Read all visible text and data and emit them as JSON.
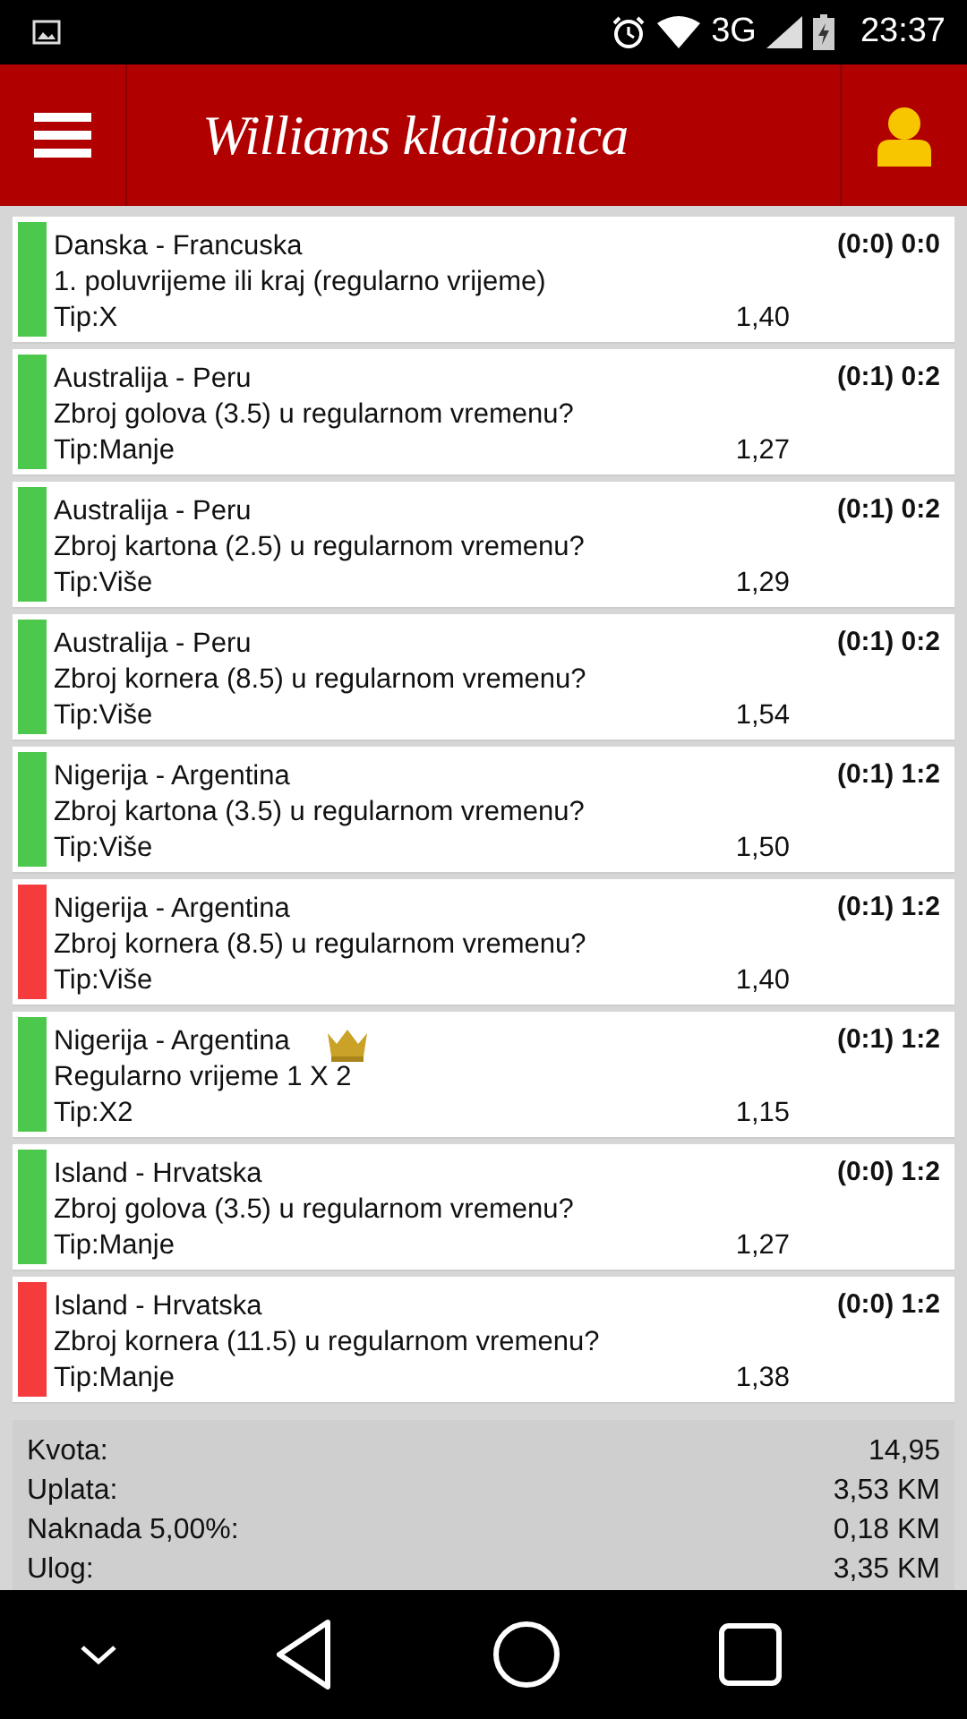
{
  "status_bar": {
    "time": "23:37",
    "network": "3G"
  },
  "header": {
    "logo": "Williams kladionica"
  },
  "bets": [
    {
      "match": "Danska - Francuska",
      "market": "1. poluvrijeme ili kraj (regularno vrijeme)",
      "tip": "Tip:X",
      "odds": "1,40",
      "score": "(0:0) 0:0",
      "color": "#4cc94c",
      "crown": false
    },
    {
      "match": "Australija - Peru",
      "market": "Zbroj golova (3.5) u regularnom vremenu?",
      "tip": "Tip:Manje",
      "odds": "1,27",
      "score": "(0:1) 0:2",
      "color": "#4cc94c",
      "crown": false
    },
    {
      "match": "Australija - Peru",
      "market": "Zbroj kartona (2.5) u regularnom vremenu?",
      "tip": "Tip:Više",
      "odds": "1,29",
      "score": "(0:1) 0:2",
      "color": "#4cc94c",
      "crown": false
    },
    {
      "match": "Australija - Peru",
      "market": "Zbroj kornera (8.5) u regularnom vremenu?",
      "tip": "Tip:Više",
      "odds": "1,54",
      "score": "(0:1) 0:2",
      "color": "#4cc94c",
      "crown": false
    },
    {
      "match": "Nigerija - Argentina",
      "market": "Zbroj kartona (3.5) u regularnom vremenu?",
      "tip": "Tip:Više",
      "odds": "1,50",
      "score": "(0:1) 1:2",
      "color": "#4cc94c",
      "crown": false
    },
    {
      "match": "Nigerija - Argentina",
      "market": "Zbroj kornera (8.5) u regularnom vremenu?",
      "tip": "Tip:Više",
      "odds": "1,40",
      "score": "(0:1) 1:2",
      "color": "#f53b3b",
      "crown": false
    },
    {
      "match": "Nigerija - Argentina",
      "market": "Regularno vrijeme 1 X 2",
      "tip": "Tip:X2",
      "odds": "1,15",
      "score": "(0:1) 1:2",
      "color": "#4cc94c",
      "crown": true
    },
    {
      "match": "Island - Hrvatska",
      "market": "Zbroj golova (3.5) u regularnom vremenu?",
      "tip": "Tip:Manje",
      "odds": "1,27",
      "score": "(0:0) 1:2",
      "color": "#4cc94c",
      "crown": false
    },
    {
      "match": "Island - Hrvatska",
      "market": "Zbroj kornera (11.5) u regularnom vremenu?",
      "tip": "Tip:Manje",
      "odds": "1,38",
      "score": "(0:0) 1:2",
      "color": "#f53b3b",
      "crown": false
    }
  ],
  "summary": [
    {
      "label": "Kvota:",
      "value": "14,95"
    },
    {
      "label": "Uplata:",
      "value": "3,53 KM"
    },
    {
      "label": "Naknada 5,00%:",
      "value": "0,18 KM"
    },
    {
      "label": "Ulog:",
      "value": "3,35 KM"
    }
  ]
}
